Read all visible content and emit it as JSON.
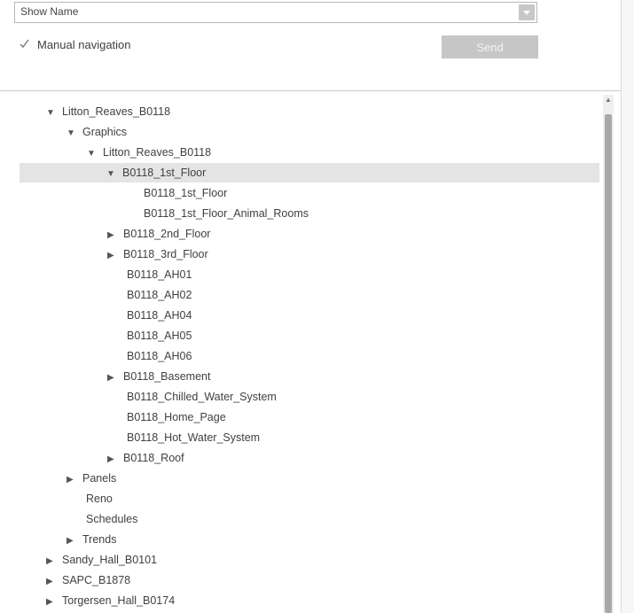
{
  "top_panel": {
    "dropdown_value": "Show Name",
    "manual_navigation_label": "Manual navigation",
    "manual_navigation_checked": true,
    "send_label": "Send"
  },
  "tree": {
    "rows": [
      {
        "label": "Litton_Reaves_B0118",
        "expander": "expanded",
        "selected": false
      },
      {
        "label": "Graphics",
        "expander": "expanded",
        "selected": false
      },
      {
        "label": "Litton_Reaves_B0118",
        "expander": "expanded",
        "selected": false
      },
      {
        "label": "B0118_1st_Floor",
        "expander": "expanded",
        "selected": true
      },
      {
        "label": "B0118_1st_Floor",
        "expander": "none",
        "selected": false
      },
      {
        "label": "B0118_1st_Floor_Animal_Rooms",
        "expander": "none",
        "selected": false
      },
      {
        "label": "B0118_2nd_Floor",
        "expander": "collapsed",
        "selected": false
      },
      {
        "label": "B0118_3rd_Floor",
        "expander": "collapsed",
        "selected": false
      },
      {
        "label": "B0118_AH01",
        "expander": "none",
        "selected": false
      },
      {
        "label": "B0118_AH02",
        "expander": "none",
        "selected": false
      },
      {
        "label": "B0118_AH04",
        "expander": "none",
        "selected": false
      },
      {
        "label": "B0118_AH05",
        "expander": "none",
        "selected": false
      },
      {
        "label": "B0118_AH06",
        "expander": "none",
        "selected": false
      },
      {
        "label": "B0118_Basement",
        "expander": "collapsed",
        "selected": false
      },
      {
        "label": "B0118_Chilled_Water_System",
        "expander": "none",
        "selected": false
      },
      {
        "label": "B0118_Home_Page",
        "expander": "none",
        "selected": false
      },
      {
        "label": "B0118_Hot_Water_System",
        "expander": "none",
        "selected": false
      },
      {
        "label": "B0118_Roof",
        "expander": "collapsed",
        "selected": false
      },
      {
        "label": "Panels",
        "expander": "collapsed",
        "selected": false
      },
      {
        "label": "Reno",
        "expander": "none",
        "selected": false
      },
      {
        "label": "Schedules",
        "expander": "none",
        "selected": false
      },
      {
        "label": "Trends",
        "expander": "collapsed",
        "selected": false
      },
      {
        "label": "Sandy_Hall_B0101",
        "expander": "collapsed",
        "selected": false
      },
      {
        "label": "SAPC_B1878",
        "expander": "collapsed",
        "selected": false
      },
      {
        "label": "Torgersen_Hall_B0174",
        "expander": "collapsed",
        "selected": false
      }
    ]
  }
}
